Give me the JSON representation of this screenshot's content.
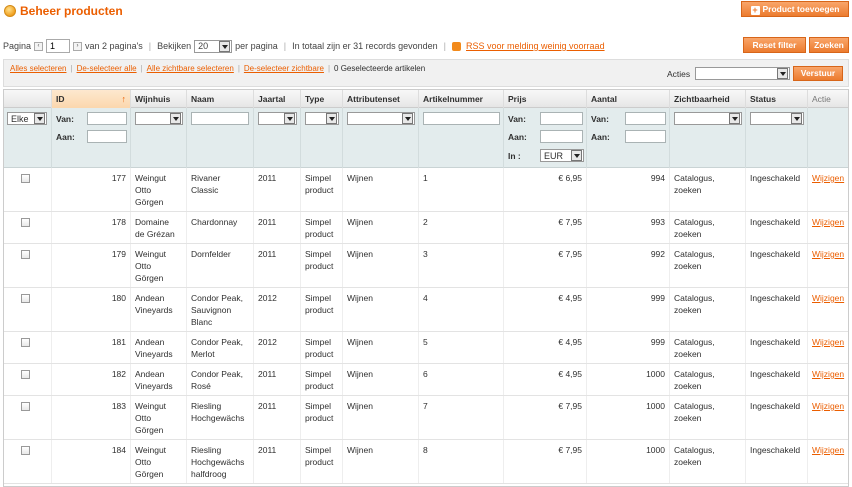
{
  "header": {
    "title": "Beheer producten",
    "add_button": "Product toevoegen"
  },
  "pager": {
    "page_label": "Pagina",
    "page_value": "1",
    "of_pages": "van 2 pagina's",
    "view_label": "Bekijken",
    "per_page_value": "20",
    "per_page_label": "per pagina",
    "total_text": "In totaal zijn er 31 records gevonden",
    "rss_link": "RSS voor melding weinig voorraad",
    "reset_button": "Reset filter",
    "search_button": "Zoeken"
  },
  "massaction": {
    "select_all": "Alles selecteren",
    "unselect_all": "De-selecteer alle",
    "select_visible": "Alle zichtbare selecteren",
    "unselect_visible": "De-selecteer zichtbare",
    "selected_count": "0 Geselecteerde artikelen",
    "actions_label": "Acties",
    "submit_button": "Verstuur"
  },
  "columns": {
    "id": "ID",
    "winery": "Wijnhuis",
    "name": "Naam",
    "year": "Jaartal",
    "type": "Type",
    "attrset": "Attributenset",
    "sku": "Artikelnummer",
    "price": "Prijs",
    "qty": "Aantal",
    "visibility": "Zichtbaarheid",
    "status": "Status",
    "action": "Actie"
  },
  "filters": {
    "any": "Elke",
    "from": "Van:",
    "to": "Aan:",
    "in": "In :",
    "currency": "EUR"
  },
  "rows": [
    {
      "id": "177",
      "winery": [
        "Weingut",
        "Otto",
        "Görgen"
      ],
      "name": [
        "Rivaner",
        "Classic"
      ],
      "year": "2011",
      "type": [
        "Simpel",
        "product"
      ],
      "attrset": "Wijnen",
      "sku": "1",
      "price": "€ 6,95",
      "qty": "994",
      "visibility": [
        "Catalogus,",
        "zoeken"
      ],
      "status": "Ingeschakeld",
      "action": "Wijzigen"
    },
    {
      "id": "178",
      "winery": [
        "Domaine",
        "de Grézan"
      ],
      "name": [
        "Chardonnay"
      ],
      "year": "2011",
      "type": [
        "Simpel",
        "product"
      ],
      "attrset": "Wijnen",
      "sku": "2",
      "price": "€ 7,95",
      "qty": "993",
      "visibility": [
        "Catalogus,",
        "zoeken"
      ],
      "status": "Ingeschakeld",
      "action": "Wijzigen"
    },
    {
      "id": "179",
      "winery": [
        "Weingut",
        "Otto",
        "Görgen"
      ],
      "name": [
        "Dornfelder"
      ],
      "year": "2011",
      "type": [
        "Simpel",
        "product"
      ],
      "attrset": "Wijnen",
      "sku": "3",
      "price": "€ 7,95",
      "qty": "992",
      "visibility": [
        "Catalogus,",
        "zoeken"
      ],
      "status": "Ingeschakeld",
      "action": "Wijzigen"
    },
    {
      "id": "180",
      "winery": [
        "Andean",
        "Vineyards"
      ],
      "name": [
        "Condor Peak,",
        "Sauvignon",
        "Blanc"
      ],
      "year": "2012",
      "type": [
        "Simpel",
        "product"
      ],
      "attrset": "Wijnen",
      "sku": "4",
      "price": "€ 4,95",
      "qty": "999",
      "visibility": [
        "Catalogus,",
        "zoeken"
      ],
      "status": "Ingeschakeld",
      "action": "Wijzigen"
    },
    {
      "id": "181",
      "winery": [
        "Andean",
        "Vineyards"
      ],
      "name": [
        "Condor Peak,",
        "Merlot"
      ],
      "year": "2012",
      "type": [
        "Simpel",
        "product"
      ],
      "attrset": "Wijnen",
      "sku": "5",
      "price": "€ 4,95",
      "qty": "999",
      "visibility": [
        "Catalogus,",
        "zoeken"
      ],
      "status": "Ingeschakeld",
      "action": "Wijzigen"
    },
    {
      "id": "182",
      "winery": [
        "Andean",
        "Vineyards"
      ],
      "name": [
        "Condor Peak,",
        "Rosé"
      ],
      "year": "2011",
      "type": [
        "Simpel",
        "product"
      ],
      "attrset": "Wijnen",
      "sku": "6",
      "price": "€ 4,95",
      "qty": "1000",
      "visibility": [
        "Catalogus,",
        "zoeken"
      ],
      "status": "Ingeschakeld",
      "action": "Wijzigen"
    },
    {
      "id": "183",
      "winery": [
        "Weingut",
        "Otto",
        "Görgen"
      ],
      "name": [
        "Riesling",
        "Hochgewächs"
      ],
      "year": "2011",
      "type": [
        "Simpel",
        "product"
      ],
      "attrset": "Wijnen",
      "sku": "7",
      "price": "€ 7,95",
      "qty": "1000",
      "visibility": [
        "Catalogus,",
        "zoeken"
      ],
      "status": "Ingeschakeld",
      "action": "Wijzigen"
    },
    {
      "id": "184",
      "winery": [
        "Weingut",
        "Otto",
        "Görgen"
      ],
      "name": [
        "Riesling",
        "Hochgewächs",
        "halfdroog"
      ],
      "year": "2011",
      "type": [
        "Simpel",
        "product"
      ],
      "attrset": "Wijnen",
      "sku": "8",
      "price": "€ 7,95",
      "qty": "1000",
      "visibility": [
        "Catalogus,",
        "zoeken"
      ],
      "status": "Ingeschakeld",
      "action": "Wijzigen"
    }
  ]
}
